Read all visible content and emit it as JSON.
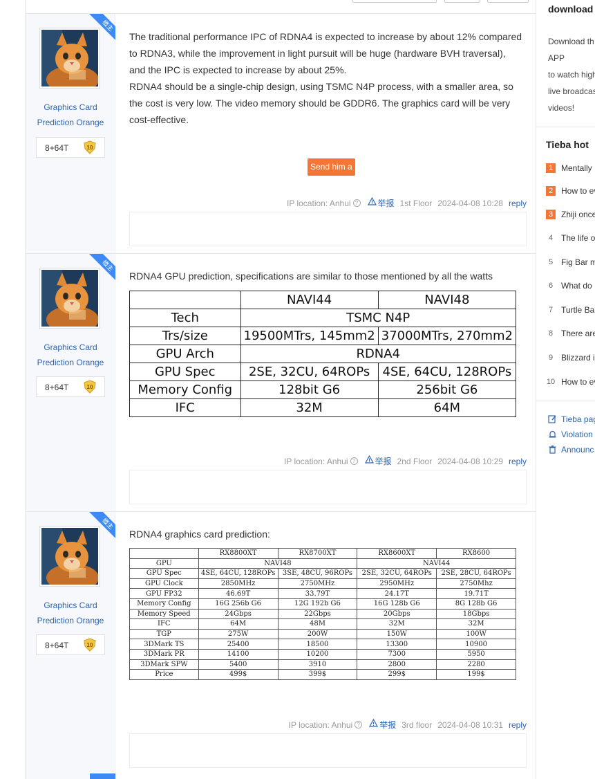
{
  "posts": [
    {
      "ribbon": "楼主",
      "author": {
        "name_line1": "Graphics Card",
        "name_line2": "Prediction Orange",
        "level_name": "8+64T",
        "level": "10"
      },
      "paragraphs": [
        "The traditional performance IPC of RDNA4 is expected to increase by about 12% compared to RDNA3, while the improvement in light pursuit will be huge (hardware BVH traversal), and the IPC is expected to increase by about 25%.",
        "RDNA4 should be a single-chip design, using TSMC N4P process, with a smaller area, so the cost is very low. The video memory should be GDDR6. The graphics card will be very cost-effective."
      ],
      "send_button": "Send him a",
      "meta": {
        "ip": "IP location: Anhui",
        "report": "举报",
        "floor": "1st Floor",
        "date": "2024-04-08 10:28",
        "reply": "reply"
      }
    },
    {
      "ribbon": "楼主",
      "author": {
        "name_line1": "Graphics Card",
        "name_line2": "Prediction Orange",
        "level_name": "8+64T",
        "level": "10"
      },
      "text": "RDNA4 GPU prediction, specifications are similar to those mentioned by all the watts",
      "table": [
        [
          "",
          "NAVI44",
          "NAVI48"
        ],
        [
          "Tech",
          "TSMC N4P"
        ],
        [
          "Trs/size",
          "19500MTrs, 145mm2",
          "37000MTrs, 270mm2"
        ],
        [
          "GPU Arch",
          "RDNA4"
        ],
        [
          "GPU Spec",
          "2SE, 32CU, 64ROPs",
          "4SE, 64CU, 128ROPs"
        ],
        [
          "Memory Config",
          "128bit G6",
          "256bit G6"
        ],
        [
          "IFC",
          "32M",
          "64M"
        ]
      ],
      "meta": {
        "ip": "IP location: Anhui",
        "report": "举报",
        "floor": "2nd Floor",
        "date": "2024-04-08 10:29",
        "reply": "reply"
      }
    },
    {
      "ribbon": "楼主",
      "author": {
        "name_line1": "Graphics Card",
        "name_line2": "Prediction Orange",
        "level_name": "8+64T",
        "level": "10"
      },
      "text": "RDNA4 graphics card prediction:",
      "table_header": [
        "",
        "RX8800XT",
        "RX8700XT",
        "RX8600XT",
        "RX8600"
      ],
      "table_gpu_row": [
        "GPU",
        "NAVI48",
        "NAVI44"
      ],
      "table_rows": [
        [
          "GPU Spec",
          "4SE, 64CU, 128ROPs",
          "3SE, 48CU, 96ROPs",
          "2SE, 32CU, 64ROPs",
          "2SE, 28CU, 64ROPs"
        ],
        [
          "GPU Clock",
          "2850MHz",
          "2750MHz",
          "2950MHz",
          "2750Mhz"
        ],
        [
          "GPU FP32",
          "46.69T",
          "33.79T",
          "24.17T",
          "19.71T"
        ],
        [
          "Memory Config",
          "16G 256b G6",
          "12G 192b G6",
          "16G 128b G6",
          "8G 128b G6"
        ],
        [
          "Memory Speed",
          "24Gbps",
          "22Gbps",
          "20Gbps",
          "18Gbps"
        ],
        [
          "IFC",
          "64M",
          "48M",
          "32M",
          "32M"
        ],
        [
          "TGP",
          "275W",
          "200W",
          "150W",
          "100W"
        ],
        [
          "3DMark TS",
          "25400",
          "18500",
          "13300",
          "10900"
        ],
        [
          "3DMark PR",
          "14100",
          "10200",
          "7300",
          "5950"
        ],
        [
          "3DMark SPW",
          "5400",
          "3910",
          "2800",
          "2280"
        ],
        [
          "Price",
          "499$",
          "399$",
          "299$",
          "199$"
        ]
      ],
      "meta": {
        "ip": "IP location: Anhui",
        "report": "举报",
        "floor": "3rd floor",
        "date": "2024-04-08 10:31",
        "reply": "reply"
      }
    }
  ],
  "sidebar": {
    "download_title": "download",
    "download_lines": [
      "Download th",
      "APP",
      "to watch high",
      "live broadcas",
      "videos!"
    ],
    "hot_title": "Tieba hot",
    "hot_items": [
      {
        "num": "1",
        "text": "Mentally"
      },
      {
        "num": "2",
        "text": "How to ev"
      },
      {
        "num": "3",
        "text": "Zhiji once"
      },
      {
        "num": "4",
        "text": "The life o"
      },
      {
        "num": "5",
        "text": "Fig Bar m"
      },
      {
        "num": "6",
        "text": "What do"
      },
      {
        "num": "7",
        "text": "Turtle Ba"
      },
      {
        "num": "8",
        "text": "There are"
      },
      {
        "num": "9",
        "text": "Blizzard i"
      },
      {
        "num": "10",
        "text": "How to ev"
      }
    ],
    "links": [
      "Tieba pag",
      "Violation",
      "Announc"
    ]
  }
}
